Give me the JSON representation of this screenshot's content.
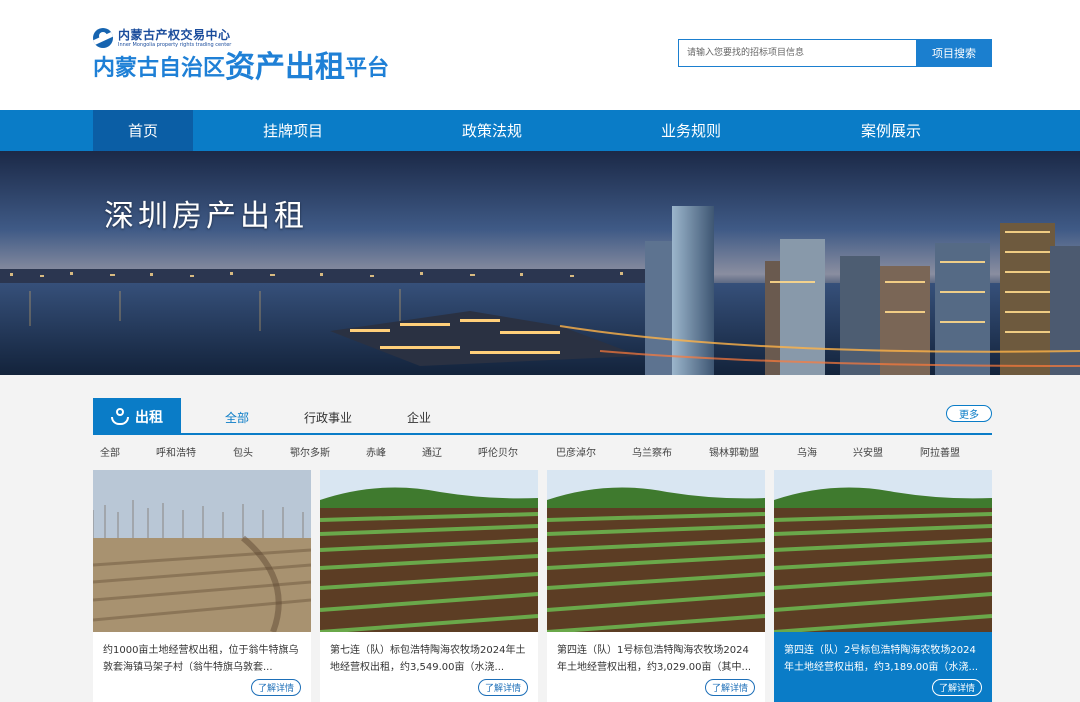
{
  "header": {
    "org_cn": "内蒙古产权交易中心",
    "org_en": "Inner Mongolia property rights trading center",
    "title_part1": "内蒙古自治区",
    "title_part2": "资产出租",
    "title_part3": "平台",
    "search_placeholder": "请输入您要找的招标项目信息",
    "search_button": "项目搜索"
  },
  "nav": {
    "items": [
      {
        "label": "首页",
        "active": true
      },
      {
        "label": "挂牌项目"
      },
      {
        "label": "政策法规"
      },
      {
        "label": "业务规则"
      },
      {
        "label": "案例展示"
      }
    ]
  },
  "banner": {
    "caption": "深圳房产出租"
  },
  "section": {
    "tab_label": "出租",
    "filters": [
      "全部",
      "行政事业",
      "企业"
    ],
    "more": "更多",
    "regions": [
      "全部",
      "呼和浩特",
      "包头",
      "鄂尔多斯",
      "赤峰",
      "通辽",
      "呼伦贝尔",
      "巴彦淖尔",
      "乌兰察布",
      "锡林郭勒盟",
      "乌海",
      "兴安盟",
      "阿拉善盟"
    ]
  },
  "cards": [
    {
      "title": "约1000亩土地经营权出租，位于翁牛特旗乌敦套海镇马架子村（翁牛特旗乌敦套...",
      "button": "了解详情",
      "image": "dry-field-photo"
    },
    {
      "title": "第七连（队）标包浩特陶海农牧场2024年土地经营权出租，约3,549.00亩（水浇...",
      "button": "了解详情",
      "image": "green-field-photo"
    },
    {
      "title": "第四连（队）1号标包浩特陶海农牧场2024年土地经营权出租，约3,029.00亩（其中...",
      "button": "了解详情",
      "image": "green-field-photo"
    },
    {
      "title": "第四连（队）2号标包浩特陶海农牧场2024年土地经营权出租，约3,189.00亩（水浇...",
      "button": "了解详情",
      "image": "green-field-photo"
    }
  ],
  "colors": {
    "primary": "#0a7cc7",
    "nav_active": "#0b5ea5",
    "title_blue": "#1f80d6"
  }
}
